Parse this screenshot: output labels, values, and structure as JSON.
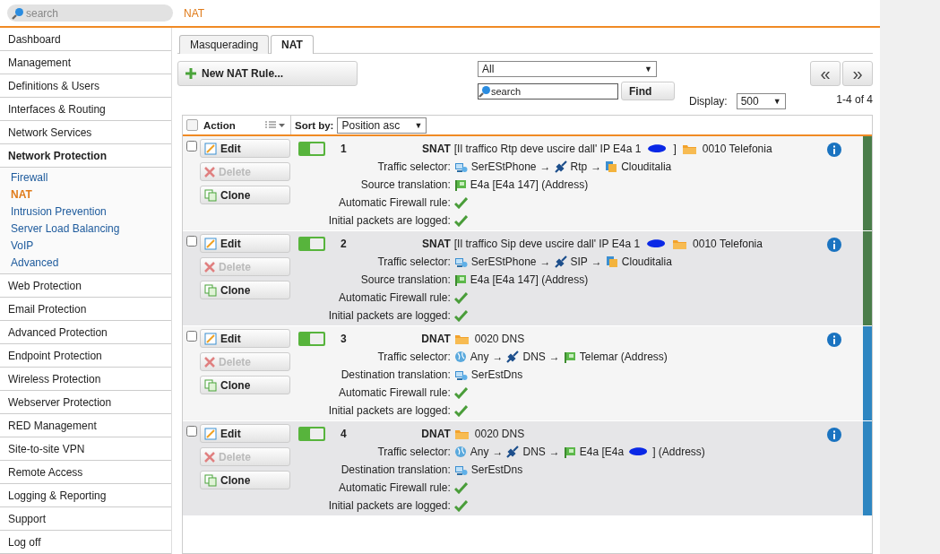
{
  "search": {
    "placeholder": "search"
  },
  "breadcrumb": "NAT",
  "nav": [
    {
      "label": "Dashboard",
      "expanded": false
    },
    {
      "label": "Management",
      "expanded": false
    },
    {
      "label": "Definitions & Users",
      "expanded": false
    },
    {
      "label": "Interfaces & Routing",
      "expanded": false
    },
    {
      "label": "Network Services",
      "expanded": false
    },
    {
      "label": "Network Protection",
      "expanded": true,
      "children": [
        {
          "label": "Firewall",
          "selected": false
        },
        {
          "label": "NAT",
          "selected": true
        },
        {
          "label": "Intrusion Prevention",
          "selected": false
        },
        {
          "label": "Server Load Balancing",
          "selected": false
        },
        {
          "label": "VoIP",
          "selected": false
        },
        {
          "label": "Advanced",
          "selected": false
        }
      ]
    },
    {
      "label": "Web Protection",
      "expanded": false
    },
    {
      "label": "Email Protection",
      "expanded": false
    },
    {
      "label": "Advanced Protection",
      "expanded": false
    },
    {
      "label": "Endpoint Protection",
      "expanded": false
    },
    {
      "label": "Wireless Protection",
      "expanded": false
    },
    {
      "label": "Webserver Protection",
      "expanded": false
    },
    {
      "label": "RED Management",
      "expanded": false
    },
    {
      "label": "Site-to-site VPN",
      "expanded": false
    },
    {
      "label": "Remote Access",
      "expanded": false
    },
    {
      "label": "Logging & Reporting",
      "expanded": false
    },
    {
      "label": "Support",
      "expanded": false
    },
    {
      "label": "Log off",
      "expanded": false
    }
  ],
  "tabs": [
    {
      "label": "Masquerading",
      "selected": false
    },
    {
      "label": "NAT",
      "selected": true
    }
  ],
  "toolbar": {
    "new_button": "New NAT Rule...",
    "filter": {
      "value": "All",
      "caret": "▼"
    },
    "search_placeholder": "search",
    "find": "Find",
    "display_label": "Display:",
    "display": {
      "value": "500",
      "caret": "▼"
    },
    "paging": "1-4 of 4",
    "prev": "«",
    "next": "»"
  },
  "table": {
    "checked": false,
    "action_header": "Action",
    "sort_label": "Sort by:",
    "sort": {
      "value": "Position asc",
      "caret": "▼"
    }
  },
  "rules": [
    {
      "number": "1",
      "type": "SNAT",
      "comment": {
        "text": [
          "[Il traffico Rtp deve uscire dall' IP E4a 1",
          "]"
        ]
      },
      "group": "0010 Telefonia",
      "enabled": true,
      "checked": false,
      "color": "#4a7d4a",
      "buttons": [
        {
          "kind": "edit",
          "label": "Edit",
          "disabled": false
        },
        {
          "kind": "delete",
          "label": "Delete",
          "disabled": true
        },
        {
          "kind": "clone",
          "label": "Clone",
          "disabled": false
        }
      ],
      "details": [
        {
          "label": "Traffic selector:",
          "kind": "objects",
          "objects": [
            {
              "kind": "host",
              "text": [
                "SerEStPhone"
              ]
            },
            {
              "kind": "arrow",
              "text": [
                "→"
              ]
            },
            {
              "kind": "service",
              "text": [
                "Rtp"
              ]
            },
            {
              "kind": "arrow",
              "text": [
                "→"
              ]
            },
            {
              "kind": "group",
              "text": [
                "Clouditalia"
              ]
            }
          ]
        },
        {
          "label": "Source translation:",
          "kind": "objects",
          "objects": [
            {
              "kind": "interface",
              "text": [
                "E4a [E4a 147] (Address)"
              ]
            }
          ]
        },
        {
          "label": "Automatic Firewall rule:",
          "kind": "check",
          "checked": true
        },
        {
          "label": "Initial packets are logged:",
          "kind": "check",
          "checked": true
        }
      ]
    },
    {
      "number": "2",
      "type": "SNAT",
      "comment": {
        "text": [
          "[Il traffico Sip deve uscire dall' IP E4a 1"
        ],
        "redacted_end": true
      },
      "group": "0010 Telefonia",
      "enabled": true,
      "checked": false,
      "color": "#4a7d4a",
      "buttons": [
        {
          "kind": "edit",
          "label": "Edit",
          "disabled": false
        },
        {
          "kind": "delete",
          "label": "Delete",
          "disabled": true
        },
        {
          "kind": "clone",
          "label": "Clone",
          "disabled": false
        }
      ],
      "details": [
        {
          "label": "Traffic selector:",
          "kind": "objects",
          "objects": [
            {
              "kind": "host",
              "text": [
                "SerEStPhone"
              ]
            },
            {
              "kind": "arrow",
              "text": [
                "→"
              ]
            },
            {
              "kind": "service",
              "text": [
                "SIP"
              ]
            },
            {
              "kind": "arrow",
              "text": [
                "→"
              ]
            },
            {
              "kind": "group",
              "text": [
                "Clouditalia"
              ]
            }
          ]
        },
        {
          "label": "Source translation:",
          "kind": "objects",
          "objects": [
            {
              "kind": "interface",
              "text": [
                "E4a [E4a 147] (Address)"
              ]
            }
          ]
        },
        {
          "label": "Automatic Firewall rule:",
          "kind": "check",
          "checked": true
        },
        {
          "label": "Initial packets are logged:",
          "kind": "check",
          "checked": true
        }
      ]
    },
    {
      "number": "3",
      "type": "DNAT",
      "group": "0020 DNS",
      "enabled": true,
      "checked": false,
      "color": "#2e86c1",
      "buttons": [
        {
          "kind": "edit",
          "label": "Edit",
          "disabled": false
        },
        {
          "kind": "delete",
          "label": "Delete",
          "disabled": true
        },
        {
          "kind": "clone",
          "label": "Clone",
          "disabled": false
        }
      ],
      "details": [
        {
          "label": "Traffic selector:",
          "kind": "objects",
          "objects": [
            {
              "kind": "globe",
              "text": [
                "Any"
              ]
            },
            {
              "kind": "arrow",
              "text": [
                "→"
              ]
            },
            {
              "kind": "service",
              "text": [
                "DNS"
              ]
            },
            {
              "kind": "arrow",
              "text": [
                "→"
              ]
            },
            {
              "kind": "interface",
              "text": [
                "Telemar (Address)"
              ]
            }
          ]
        },
        {
          "label": "Destination translation:",
          "kind": "objects",
          "objects": [
            {
              "kind": "host",
              "text": [
                "SerEstDns"
              ]
            }
          ]
        },
        {
          "label": "Automatic Firewall rule:",
          "kind": "check",
          "checked": true
        },
        {
          "label": "Initial packets are logged:",
          "kind": "check",
          "checked": true
        }
      ]
    },
    {
      "number": "4",
      "type": "DNAT",
      "group": "0020 DNS",
      "enabled": true,
      "checked": false,
      "color": "#2e86c1",
      "buttons": [
        {
          "kind": "edit",
          "label": "Edit",
          "disabled": false
        },
        {
          "kind": "delete",
          "label": "Delete",
          "disabled": true
        },
        {
          "kind": "clone",
          "label": "Clone",
          "disabled": false
        }
      ],
      "details": [
        {
          "label": "Traffic selector:",
          "kind": "objects",
          "objects": [
            {
              "kind": "globe",
              "text": [
                "Any"
              ]
            },
            {
              "kind": "arrow",
              "text": [
                "→"
              ]
            },
            {
              "kind": "service",
              "text": [
                "DNS"
              ]
            },
            {
              "kind": "arrow",
              "text": [
                "→"
              ]
            },
            {
              "kind": "interface",
              "text": [
                "E4a [E4a",
                "] (Address)"
              ]
            }
          ]
        },
        {
          "label": "Destination translation:",
          "kind": "objects",
          "objects": [
            {
              "kind": "host",
              "text": [
                "SerEstDns"
              ]
            }
          ]
        },
        {
          "label": "Automatic Firewall rule:",
          "kind": "check",
          "checked": true
        },
        {
          "label": "Initial packets are logged:",
          "kind": "check",
          "checked": true
        }
      ]
    }
  ]
}
